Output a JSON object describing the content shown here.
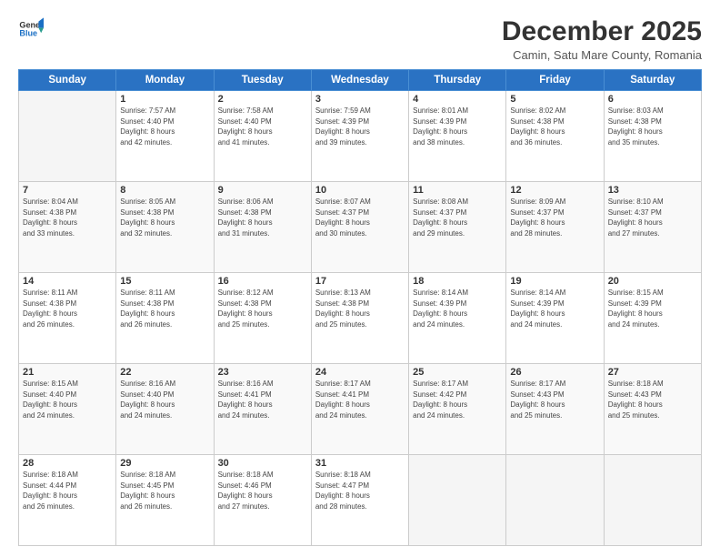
{
  "logo": {
    "line1": "General",
    "line2": "Blue"
  },
  "title": "December 2025",
  "subtitle": "Camin, Satu Mare County, Romania",
  "days_header": [
    "Sunday",
    "Monday",
    "Tuesday",
    "Wednesday",
    "Thursday",
    "Friday",
    "Saturday"
  ],
  "weeks": [
    [
      {
        "day": "",
        "info": ""
      },
      {
        "day": "1",
        "info": "Sunrise: 7:57 AM\nSunset: 4:40 PM\nDaylight: 8 hours\nand 42 minutes."
      },
      {
        "day": "2",
        "info": "Sunrise: 7:58 AM\nSunset: 4:40 PM\nDaylight: 8 hours\nand 41 minutes."
      },
      {
        "day": "3",
        "info": "Sunrise: 7:59 AM\nSunset: 4:39 PM\nDaylight: 8 hours\nand 39 minutes."
      },
      {
        "day": "4",
        "info": "Sunrise: 8:01 AM\nSunset: 4:39 PM\nDaylight: 8 hours\nand 38 minutes."
      },
      {
        "day": "5",
        "info": "Sunrise: 8:02 AM\nSunset: 4:38 PM\nDaylight: 8 hours\nand 36 minutes."
      },
      {
        "day": "6",
        "info": "Sunrise: 8:03 AM\nSunset: 4:38 PM\nDaylight: 8 hours\nand 35 minutes."
      }
    ],
    [
      {
        "day": "7",
        "info": "Sunrise: 8:04 AM\nSunset: 4:38 PM\nDaylight: 8 hours\nand 33 minutes."
      },
      {
        "day": "8",
        "info": "Sunrise: 8:05 AM\nSunset: 4:38 PM\nDaylight: 8 hours\nand 32 minutes."
      },
      {
        "day": "9",
        "info": "Sunrise: 8:06 AM\nSunset: 4:38 PM\nDaylight: 8 hours\nand 31 minutes."
      },
      {
        "day": "10",
        "info": "Sunrise: 8:07 AM\nSunset: 4:37 PM\nDaylight: 8 hours\nand 30 minutes."
      },
      {
        "day": "11",
        "info": "Sunrise: 8:08 AM\nSunset: 4:37 PM\nDaylight: 8 hours\nand 29 minutes."
      },
      {
        "day": "12",
        "info": "Sunrise: 8:09 AM\nSunset: 4:37 PM\nDaylight: 8 hours\nand 28 minutes."
      },
      {
        "day": "13",
        "info": "Sunrise: 8:10 AM\nSunset: 4:37 PM\nDaylight: 8 hours\nand 27 minutes."
      }
    ],
    [
      {
        "day": "14",
        "info": "Sunrise: 8:11 AM\nSunset: 4:38 PM\nDaylight: 8 hours\nand 26 minutes."
      },
      {
        "day": "15",
        "info": "Sunrise: 8:11 AM\nSunset: 4:38 PM\nDaylight: 8 hours\nand 26 minutes."
      },
      {
        "day": "16",
        "info": "Sunrise: 8:12 AM\nSunset: 4:38 PM\nDaylight: 8 hours\nand 25 minutes."
      },
      {
        "day": "17",
        "info": "Sunrise: 8:13 AM\nSunset: 4:38 PM\nDaylight: 8 hours\nand 25 minutes."
      },
      {
        "day": "18",
        "info": "Sunrise: 8:14 AM\nSunset: 4:39 PM\nDaylight: 8 hours\nand 24 minutes."
      },
      {
        "day": "19",
        "info": "Sunrise: 8:14 AM\nSunset: 4:39 PM\nDaylight: 8 hours\nand 24 minutes."
      },
      {
        "day": "20",
        "info": "Sunrise: 8:15 AM\nSunset: 4:39 PM\nDaylight: 8 hours\nand 24 minutes."
      }
    ],
    [
      {
        "day": "21",
        "info": "Sunrise: 8:15 AM\nSunset: 4:40 PM\nDaylight: 8 hours\nand 24 minutes."
      },
      {
        "day": "22",
        "info": "Sunrise: 8:16 AM\nSunset: 4:40 PM\nDaylight: 8 hours\nand 24 minutes."
      },
      {
        "day": "23",
        "info": "Sunrise: 8:16 AM\nSunset: 4:41 PM\nDaylight: 8 hours\nand 24 minutes."
      },
      {
        "day": "24",
        "info": "Sunrise: 8:17 AM\nSunset: 4:41 PM\nDaylight: 8 hours\nand 24 minutes."
      },
      {
        "day": "25",
        "info": "Sunrise: 8:17 AM\nSunset: 4:42 PM\nDaylight: 8 hours\nand 24 minutes."
      },
      {
        "day": "26",
        "info": "Sunrise: 8:17 AM\nSunset: 4:43 PM\nDaylight: 8 hours\nand 25 minutes."
      },
      {
        "day": "27",
        "info": "Sunrise: 8:18 AM\nSunset: 4:43 PM\nDaylight: 8 hours\nand 25 minutes."
      }
    ],
    [
      {
        "day": "28",
        "info": "Sunrise: 8:18 AM\nSunset: 4:44 PM\nDaylight: 8 hours\nand 26 minutes."
      },
      {
        "day": "29",
        "info": "Sunrise: 8:18 AM\nSunset: 4:45 PM\nDaylight: 8 hours\nand 26 minutes."
      },
      {
        "day": "30",
        "info": "Sunrise: 8:18 AM\nSunset: 4:46 PM\nDaylight: 8 hours\nand 27 minutes."
      },
      {
        "day": "31",
        "info": "Sunrise: 8:18 AM\nSunset: 4:47 PM\nDaylight: 8 hours\nand 28 minutes."
      },
      {
        "day": "",
        "info": ""
      },
      {
        "day": "",
        "info": ""
      },
      {
        "day": "",
        "info": ""
      }
    ]
  ]
}
